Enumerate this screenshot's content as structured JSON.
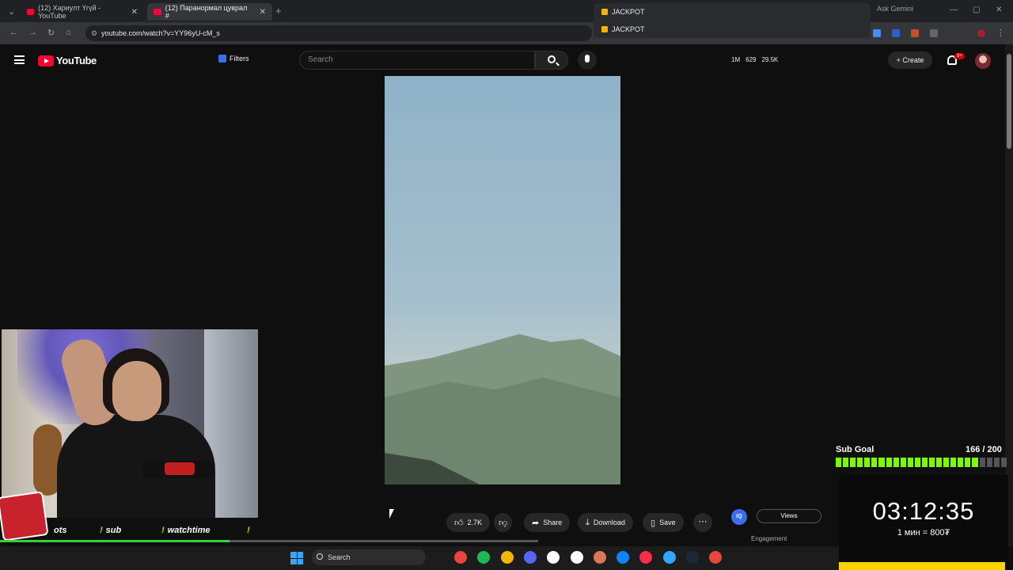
{
  "browser": {
    "tabs": [
      {
        "label": "(12) Хариулт Үгүй - YouTube",
        "close": "✕"
      },
      {
        "label": "(12) Паранормал цуврал #",
        "close": "✕"
      }
    ],
    "new_tab": "+",
    "url": "youtube.com/watch?v=YY96yU-cM_s",
    "popup": {
      "items": [
        "JACKPOT",
        "JACKPOT"
      ]
    },
    "ask_gemini": "Ask Gemini"
  },
  "youtube": {
    "logo_text": "YouTube",
    "filters_label": "Filters",
    "search_placeholder": "Search",
    "stats": [
      "1M",
      "629",
      "29.5K"
    ],
    "create_label": "Create",
    "notif_badge": "9+",
    "actions": {
      "likes": "2.7K",
      "share": "Share",
      "download": "Download",
      "save": "Save"
    },
    "iq_label": "IQ",
    "views_tab": "Views",
    "engagement": "Engagement"
  },
  "stream_overlay": {
    "commands": [
      "ots",
      "sub",
      "watchtime"
    ],
    "sub_goal_label": "Sub Goal",
    "sub_goal_count": "166 / 200",
    "sub_goal_progress": 0.83,
    "timer": "03:12:35",
    "timer_rate": "1 мин = 800₮"
  },
  "taskbar": {
    "search_label": "Search",
    "apps": [
      "chrome-icon",
      "spotify-icon",
      "explorer-icon",
      "discord-icon",
      "capcut-icon",
      "notion-icon",
      "claude-icon",
      "edge-icon",
      "music-icon",
      "photoshop-icon",
      "steam-icon",
      "chrome-icon"
    ]
  },
  "colors": {
    "youtube_red": "#ff0033",
    "goal_green": "#7cfc00",
    "timer_yellow": "#ffd400"
  }
}
